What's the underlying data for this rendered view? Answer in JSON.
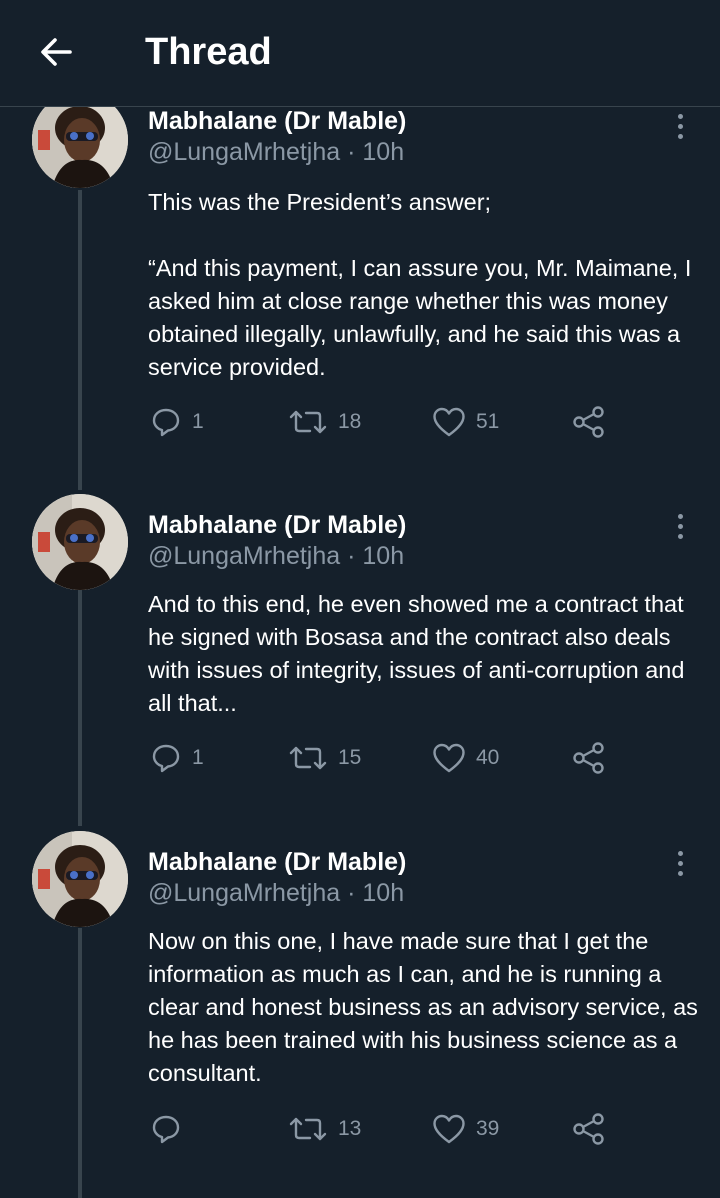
{
  "header": {
    "title": "Thread",
    "back_icon": "arrow-left-icon"
  },
  "colors": {
    "background": "#15202b",
    "secondary_text": "#8b98a5",
    "divider": "#38444d"
  },
  "tweets": [
    {
      "name": "Mabhalane (Dr Mable)",
      "handle": "@LungaMrhetjha",
      "separator": " · ",
      "time": "10h",
      "text": "This was the President’s answer;\n\n“And this payment, I can assure you, Mr. Maimane, I asked him at close range whether this was money obtained illegally, unlawfully, and he said this was a service provided.",
      "replies": "1",
      "retweets": "18",
      "likes": "51"
    },
    {
      "name": "Mabhalane (Dr Mable)",
      "handle": "@LungaMrhetjha",
      "separator": " · ",
      "time": "10h",
      "text": "And to this end, he even showed me a contract that he signed with Bosasa and the contract also deals with issues of integrity, issues of anti-corruption and all that...",
      "replies": "1",
      "retweets": "15",
      "likes": "40"
    },
    {
      "name": "Mabhalane (Dr Mable)",
      "handle": "@LungaMrhetjha",
      "separator": " · ",
      "time": "10h",
      "text": "Now on this one, I have made sure that I get the information as much as I can, and he is running a clear and honest business as an advisory service, as he has been trained with his business science as a consultant.",
      "replies": "",
      "retweets": "13",
      "likes": "39"
    }
  ]
}
